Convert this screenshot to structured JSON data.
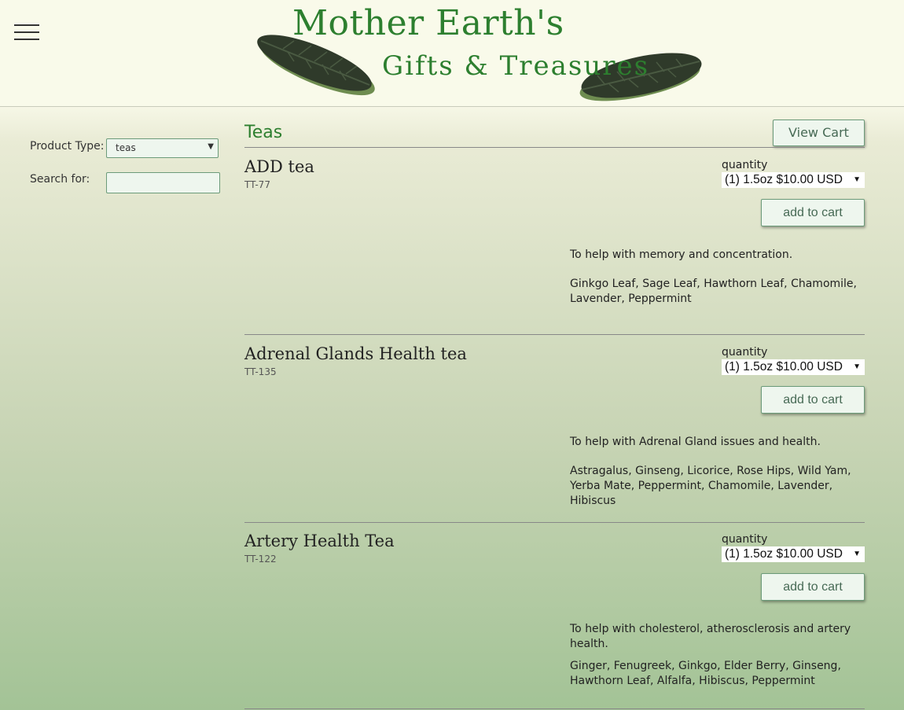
{
  "header": {
    "menu_icon": "hamburger-menu-icon",
    "logo_line1": "Mother Earth's",
    "logo_line2": "Gifts & Treasures",
    "brand_color": "#2d7f2f"
  },
  "sidebar": {
    "product_type_label": "Product Type:",
    "product_type_value": "teas",
    "search_label": "Search for:",
    "search_value": ""
  },
  "main": {
    "section_title": "Teas",
    "view_cart_label": "View Cart",
    "products": [
      {
        "name": "ADD tea",
        "sku": "TT-77",
        "quantity_label": "quantity",
        "quantity_value": "(1) 1.5oz $10.00 USD",
        "add_label": "add to cart",
        "description": "To help with memory and concentration.",
        "ingredients": "Ginkgo Leaf, Sage Leaf, Hawthorn Leaf, Chamomile, Lavender, Peppermint"
      },
      {
        "name": "Adrenal Glands Health tea",
        "sku": "TT-135",
        "quantity_label": "quantity",
        "quantity_value": "(1) 1.5oz $10.00 USD",
        "add_label": "add to cart",
        "description": "To help with Adrenal Gland issues and health.",
        "ingredients": "Astragalus, Ginseng, Licorice, Rose Hips, Wild Yam, Yerba Mate, Peppermint, Chamomile, Lavender, Hibiscus"
      },
      {
        "name": "Artery Health Tea",
        "sku": "TT-122",
        "quantity_label": "quantity",
        "quantity_value": "(1) 1.5oz $10.00 USD",
        "add_label": "add to cart",
        "description": "To help with cholesterol, atherosclerosis and artery health.",
        "ingredients": "Ginger, Fenugreek, Ginkgo, Elder Berry, Ginseng, Hawthorn Leaf, Alfalfa, Hibiscus, Peppermint"
      }
    ]
  }
}
